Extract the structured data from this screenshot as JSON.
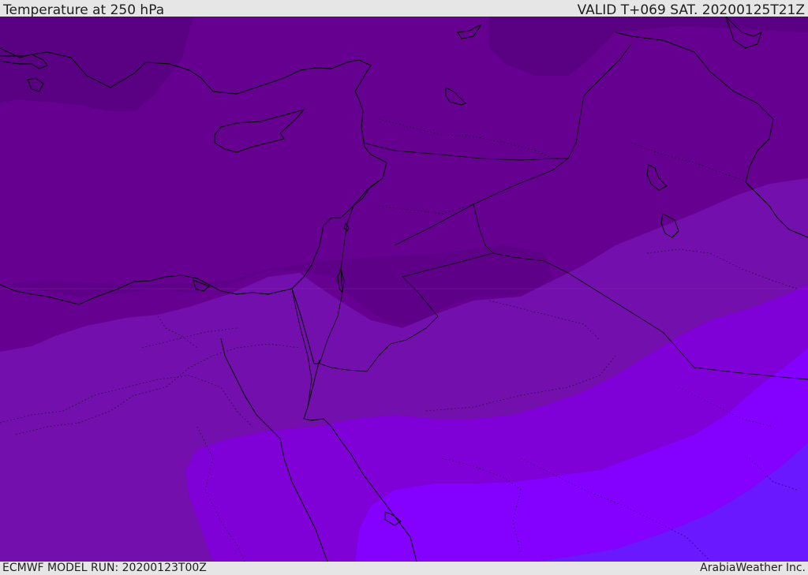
{
  "header": {
    "title": "Temperature at 250 hPa",
    "valid": "VALID T+069 SAT. 20200125T21Z"
  },
  "footer": {
    "model_run": "ECMWF MODEL RUN: 20200123T00Z",
    "credit": "ArabiaWeather Inc."
  },
  "colors": {
    "band_darkest": "#5a0082",
    "band_dark": "#650090",
    "band_mid": "#7310ad",
    "band_bright": "#8000d8",
    "band_brightest": "#8400ff",
    "band_blue": "#6a18ff",
    "borders": "#000000"
  }
}
